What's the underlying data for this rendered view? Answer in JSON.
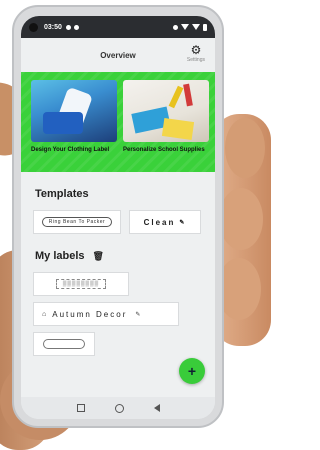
{
  "status_bar": {
    "time": "03:50"
  },
  "app_bar": {
    "title": "Overview",
    "settings_label": "Settings",
    "settings_icon": "gear-icon"
  },
  "featured": {
    "cards": [
      {
        "caption": "Design Your Clothing Label"
      },
      {
        "caption": "Personalize School Supplies"
      }
    ]
  },
  "templates": {
    "title": "Templates",
    "items": [
      {
        "text": "Ring Bean To Packer"
      },
      {
        "text": "Clean"
      }
    ]
  },
  "my_labels": {
    "title": "My labels",
    "items": [
      {
        "text": "Autumn Decor"
      }
    ]
  },
  "fab": {
    "symbol": "+"
  },
  "colors": {
    "accent": "#39cc3a",
    "banner": "#3ad13a",
    "background": "#eef0f1"
  }
}
